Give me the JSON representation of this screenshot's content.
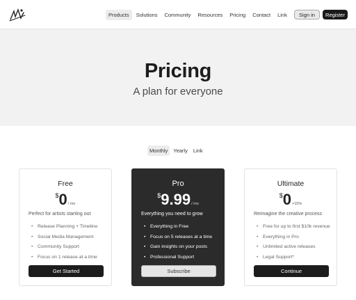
{
  "nav": {
    "items": [
      "Products",
      "Solutions",
      "Community",
      "Resources",
      "Pricing",
      "Contact",
      "Link"
    ],
    "active_index": 0,
    "sign_in": "Sign in",
    "register": "Register"
  },
  "hero": {
    "title": "Pricing",
    "subtitle": "A plan for everyone"
  },
  "billing_toggle": {
    "items": [
      "Monthly",
      "Yearly",
      "Link"
    ],
    "active_index": 0
  },
  "plans": [
    {
      "name": "Free",
      "currency": "$",
      "amount": "0",
      "unit": "/ mo",
      "description": "Perfect for artists starting out",
      "features": [
        "Release Planning + Timeline",
        "Social Media Management",
        "Community Support",
        "Focus on 1 release at a time"
      ],
      "cta": "Get Started"
    },
    {
      "name": "Pro",
      "currency": "$",
      "amount": "9.99",
      "unit": "/ mo",
      "description": "Everything you need to grow",
      "features": [
        "Everything in Free",
        "Focus on 5 releases at a time",
        "Gain insights on your posts",
        "Professional Support"
      ],
      "cta": "Subscribe"
    },
    {
      "name": "Ultimate",
      "currency": "$",
      "amount": "0",
      "unit": "+15%",
      "description": "Reimagine the creative process",
      "features": [
        "Free for up to first $10k revenue",
        "Everything in Pro",
        "Unlimited active releases",
        "Legal Support*"
      ],
      "cta": "Continue"
    }
  ],
  "colors": {
    "dark": "#2b2b2b",
    "hero_bg": "#f2f2f2",
    "button_dark": "#1c1c1c"
  }
}
